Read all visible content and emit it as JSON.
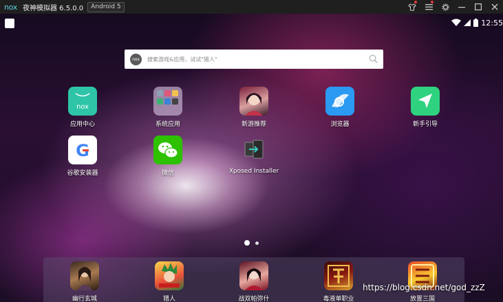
{
  "titlebar": {
    "logo_text": "nox",
    "title": "夜神模拟器 6.5.0.0",
    "android_version": "Android 5"
  },
  "status": {
    "time": "12:55"
  },
  "search": {
    "logo_text": "nox",
    "placeholder": "搜索游戏&应用，试试\"猎人\""
  },
  "apps": [
    {
      "label": "应用中心",
      "icon": "nox-app-center-icon"
    },
    {
      "label": "系统应用",
      "icon": "system-apps-folder-icon"
    },
    {
      "label": "新游推荐",
      "icon": "new-games-icon"
    },
    {
      "label": "浏览器",
      "icon": "browser-icon"
    },
    {
      "label": "新手引导",
      "icon": "beginner-guide-icon"
    },
    {
      "label": "谷歌安装器",
      "icon": "google-installer-icon"
    },
    {
      "label": "微信",
      "icon": "wechat-icon"
    },
    {
      "label": "Xposed Installer",
      "icon": "xposed-installer-icon"
    }
  ],
  "dock": [
    {
      "label": "幽行玄城",
      "icon": "game-youxingxuancheng-icon"
    },
    {
      "label": "猎人",
      "icon": "game-hunter-icon"
    },
    {
      "label": "战双帕弥什",
      "icon": "game-punishing-icon"
    },
    {
      "label": "毒液单职业",
      "icon": "game-legend-icon"
    },
    {
      "label": "放置三国",
      "icon": "game-three-kingdoms-icon"
    }
  ],
  "watermark": "https://blog.csdn.net/god_zzZ",
  "colors": {
    "app_center": "#2ec4a8",
    "browser": "#2b9af3",
    "guide": "#2ed27f",
    "wechat": "#2dc100"
  }
}
